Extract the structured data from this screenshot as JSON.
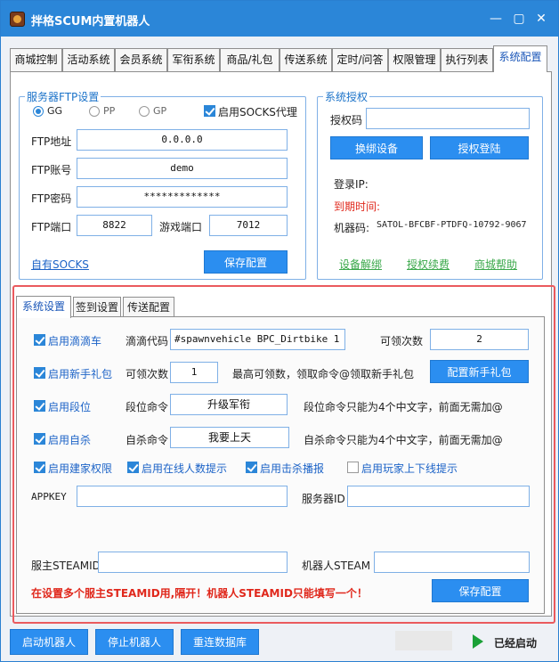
{
  "window": {
    "title": "拌格SCUM内置机器人",
    "min": "—",
    "max": "▢",
    "close": "✕"
  },
  "tabs": [
    "商城控制",
    "活动系统",
    "会员系统",
    "军衔系统",
    "商品/礼包",
    "传送系统",
    "定时/问答",
    "权限管理",
    "执行列表",
    "系统配置"
  ],
  "ftp": {
    "legend": "服务器FTP设置",
    "radio_gg": "GG",
    "radio_pp": "PP",
    "radio_gp": "GP",
    "socks_label": "启用SOCKS代理",
    "addr_label": "FTP地址",
    "addr": "0.0.0.0",
    "user_label": "FTP账号",
    "user": "demo",
    "pass_label": "FTP密码",
    "pass": "*************",
    "port_label": "FTP端口",
    "port": "8822",
    "game_port_label": "游戏端口",
    "game_port": "7012",
    "self_socks": "自有SOCKS",
    "save": "保存配置"
  },
  "auth": {
    "legend": "系统授权",
    "code_label": "授权码",
    "code": "",
    "rebind": "换绑设备",
    "login": "授权登陆",
    "ip_label": "登录IP:",
    "expire_label": "到期时间:",
    "machine_label": "机器码:",
    "machine": "SATOL-BFCBF-PTDFQ-10792-9067",
    "unbind": "设备解绑",
    "renew": "授权续费",
    "help": "商城帮助"
  },
  "subtabs": [
    "系统设置",
    "签到设置",
    "传送配置"
  ],
  "sys": {
    "dd_label": "启用滴滴车",
    "dd_code_label": "滴滴代码",
    "dd_code": "#spawnvehicle BPC_Dirtbike  1",
    "dd_times_label": "可领次数",
    "dd_times": "2",
    "gift_label": "启用新手礼包",
    "gift_times_label": "可领次数",
    "gift_times": "1",
    "gift_tip": "最高可领数，领取命令@领取新手礼包",
    "gift_btn": "配置新手礼包",
    "rank_label": "启用段位",
    "rank_cmd_label": "段位命令",
    "rank_cmd": "升级军衔",
    "rank_tip": "段位命令只能为4个中文字，前面无需加@",
    "kill_label": "启用自杀",
    "kill_cmd_label": "自杀命令",
    "kill_cmd": "我要上天",
    "kill_tip": "自杀命令只能为4个中文字，前面无需加@",
    "home_label": "启用建家权限",
    "online_label": "启用在线人数提示",
    "killcast_label": "启用击杀播报",
    "updown_label": "启用玩家上下线提示",
    "appkey_label": "APPKEY",
    "appkey": "",
    "server_id_label": "服务器ID",
    "server_id": "",
    "owner_label": "服主STEAMID",
    "owner": "",
    "bot_label": "机器人STEAM",
    "bot": "",
    "warn": "在设置多个服主STEAMID用,隔开！机器人STEAMID只能填写一个！",
    "save": "保存配置"
  },
  "bottom": {
    "start": "启动机器人",
    "stop": "停止机器人",
    "reconnect": "重连数据库",
    "status": "已经启动"
  },
  "colors": {
    "accent": "#2b86d8",
    "highlight_border": "#ea5a5e"
  }
}
